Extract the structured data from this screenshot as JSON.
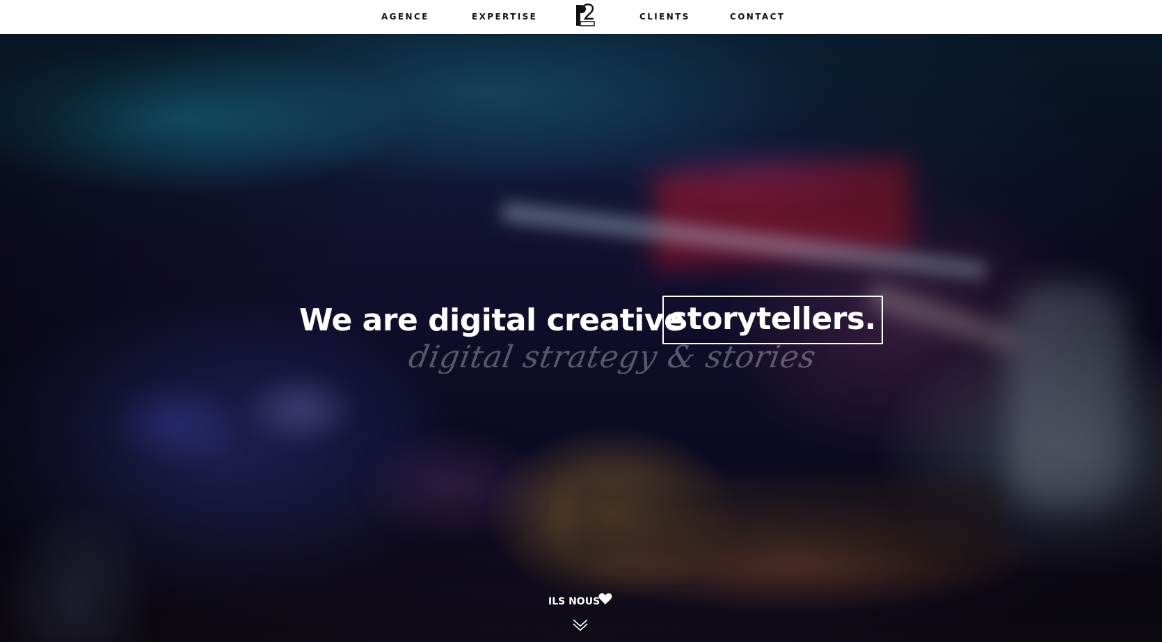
{
  "nav": {
    "items": [
      {
        "label": "AGENCE"
      },
      {
        "label": "EXPERTISE"
      },
      {
        "label": "CLIENTS"
      },
      {
        "label": "CONTACT"
      }
    ],
    "logo_icon": "p2-logo-icon"
  },
  "hero": {
    "headline_lead": "We are digital creative",
    "headline_boxed": "storytellers.",
    "script_tagline": "digital strategy & stories",
    "love_label": "ILS NOUS",
    "heart_icon": "heart-icon",
    "down_icon": "chevron-down-icon"
  },
  "colors": {
    "nav_bg": "#ffffff",
    "nav_text": "#111111",
    "hero_text": "#ffffff"
  }
}
